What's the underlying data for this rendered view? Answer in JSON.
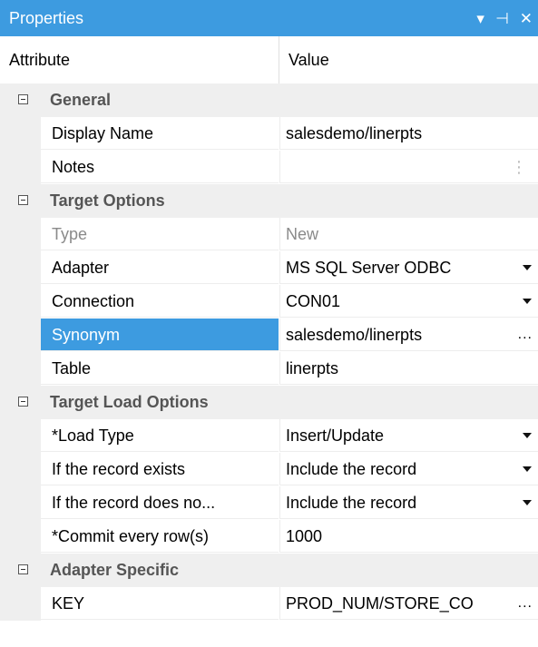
{
  "window": {
    "title": "Properties"
  },
  "title_controls": {
    "dropdown_icon": "▾",
    "pin_icon": "⊣",
    "close_icon": "✕"
  },
  "header": {
    "attribute": "Attribute",
    "value": "Value"
  },
  "categories": [
    {
      "label": "General",
      "rows": [
        {
          "name": "Display Name",
          "value": "salesdemo/linerpts"
        },
        {
          "name": "Notes",
          "value": ""
        }
      ]
    },
    {
      "label": "Target Options",
      "rows": [
        {
          "name": "Type",
          "value": "New"
        },
        {
          "name": "Adapter",
          "value": "MS SQL Server ODBC"
        },
        {
          "name": "Connection",
          "value": "CON01"
        },
        {
          "name": "Synonym",
          "value": "salesdemo/linerpts"
        },
        {
          "name": "Table",
          "value": "linerpts"
        }
      ]
    },
    {
      "label": "Target Load Options",
      "rows": [
        {
          "name": "*Load Type",
          "value": "Insert/Update"
        },
        {
          "name": "If the record exists",
          "value": "Include the record"
        },
        {
          "name": "If the record does no...",
          "value": "Include the record"
        },
        {
          "name": "*Commit every row(s)",
          "value": "1000"
        }
      ]
    },
    {
      "label": "Adapter Specific",
      "rows": [
        {
          "name": "KEY",
          "value": "PROD_NUM/STORE_CO"
        }
      ]
    }
  ],
  "ellipsis": "...",
  "colors": {
    "titlebar": "#3d9be0",
    "selected": "#3d9be0",
    "category_bg": "#efefef"
  }
}
